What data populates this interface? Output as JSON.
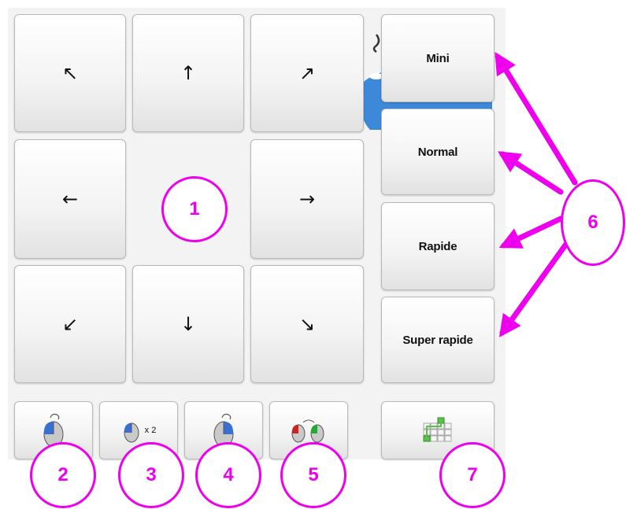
{
  "pad": {
    "arrows": {
      "up_left": "↖",
      "up": "↑",
      "up_right": "↗",
      "left": "←",
      "right": "→",
      "down_left": "↙",
      "down": "↓",
      "down_right": "↘"
    }
  },
  "speed": {
    "mini": "Mini",
    "normal": "Normal",
    "rapide": "Rapide",
    "super_rapide": "Super rapide"
  },
  "mouse_buttons": {
    "double_click_label": "x 2"
  },
  "callouts": {
    "c1": "1",
    "c2": "2",
    "c3": "3",
    "c4": "4",
    "c5": "5",
    "c6": "6",
    "c7": "7"
  },
  "colors": {
    "accent": "#ee00ee",
    "mouse_blue": "#3a6fd1",
    "mouse_red": "#cc2222",
    "mouse_green": "#22aa33",
    "keypad_green": "#5ac24a"
  },
  "icons": {
    "left_click": "mouse-left-click-icon",
    "double_click": "mouse-double-click-icon",
    "right_click": "mouse-right-click-icon",
    "drag": "mouse-drag-icon",
    "keypad": "keypad-icon"
  }
}
